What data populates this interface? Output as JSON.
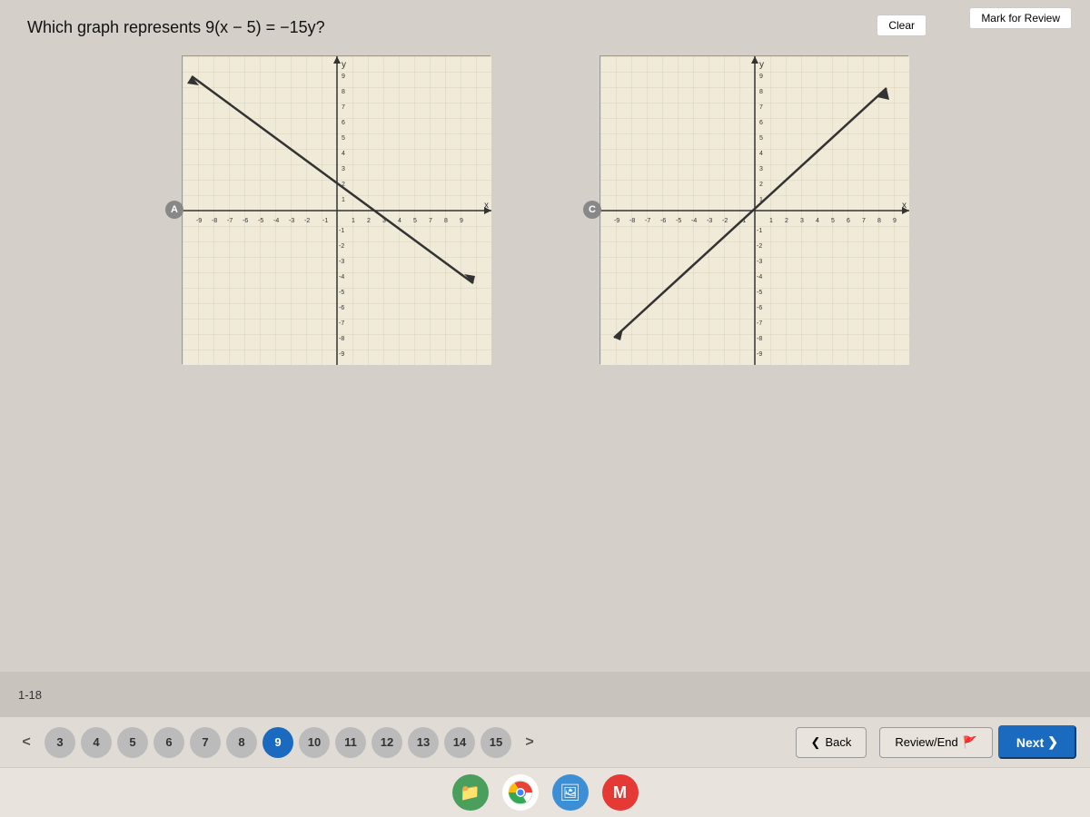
{
  "question": {
    "text": "Which graph represents 9(x − 5) = −15y?",
    "number": "1-18"
  },
  "toolbar": {
    "clear_label": "Clear",
    "mark_label": "Mark for Review"
  },
  "graphs": [
    {
      "id": "A",
      "label": "A",
      "type": "line_down_right"
    },
    {
      "id": "C",
      "label": "C",
      "type": "line_up_right"
    }
  ],
  "navigation": {
    "prev_arrow": "<",
    "next_arrow": ">",
    "page_numbers": [
      "3",
      "4",
      "5",
      "6",
      "7",
      "8",
      "9",
      "10",
      "11",
      "12",
      "13",
      "14",
      "15"
    ],
    "active_page": "9",
    "back_label": "Back",
    "review_label": "Review/End",
    "next_label": "Next"
  },
  "taskbar": {
    "icons": [
      "files-icon",
      "chrome-icon",
      "gallery-icon",
      "mail-icon"
    ]
  }
}
